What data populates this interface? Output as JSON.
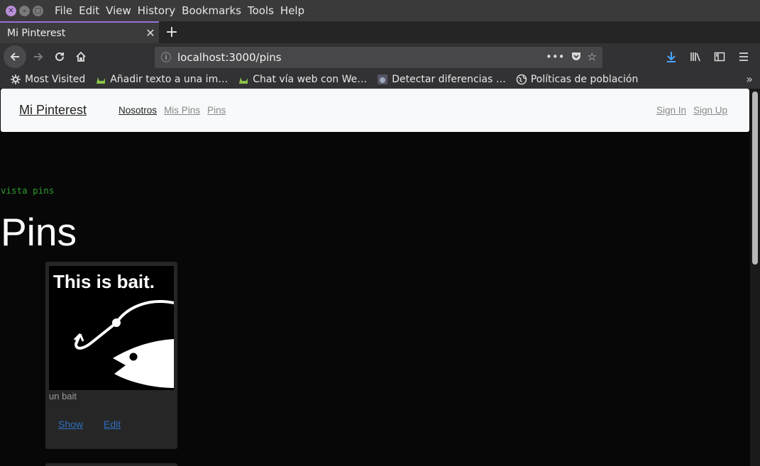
{
  "menubar": {
    "items": [
      "File",
      "Edit",
      "View",
      "History",
      "Bookmarks",
      "Tools",
      "Help"
    ]
  },
  "tabs": [
    {
      "title": "Mi Pinterest",
      "active": true
    }
  ],
  "navbar": {
    "url": "localhost:3000/pins"
  },
  "bookmarks": [
    {
      "label": "Most Visited",
      "icon": "gear-icon"
    },
    {
      "label": "Añadir texto a una im…",
      "icon": "dinosaur-icon"
    },
    {
      "label": "Chat vía web con We…",
      "icon": "dinosaur-icon"
    },
    {
      "label": "Detectar diferencias …",
      "icon": "site-icon"
    },
    {
      "label": "Políticas de población",
      "icon": "globe-icon"
    }
  ],
  "site": {
    "brand": "Mi Pinterest",
    "nav": [
      {
        "label": "Nosotros",
        "active": true
      },
      {
        "label": "Mis Pins",
        "active": false
      },
      {
        "label": "Pins",
        "active": false
      }
    ],
    "sign_in": "Sign In",
    "sign_up": "Sign Up"
  },
  "page": {
    "debug_label": "vista pins",
    "title": "Pins"
  },
  "pins": [
    {
      "image_text": "This is bait.",
      "description": "un bait",
      "show_label": "Show",
      "edit_label": "Edit"
    }
  ],
  "colors": {
    "tab_accent": "#9a71d6",
    "link": "#2f6fbf",
    "debug_text": "#2e9d2e",
    "download_icon": "#4aa3ff"
  }
}
